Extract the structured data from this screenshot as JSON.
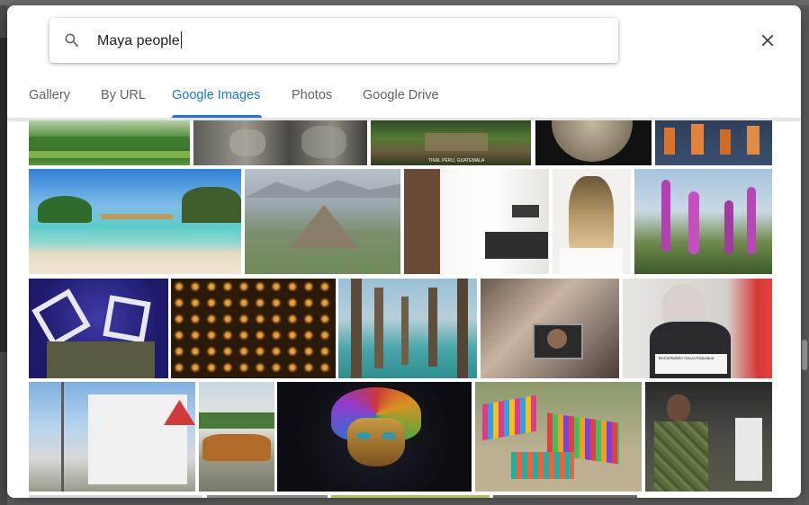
{
  "search": {
    "query": "Maya people"
  },
  "icons": {
    "search": "search-icon",
    "close": "close-icon"
  },
  "tabs": [
    {
      "label": "Gallery",
      "active": false
    },
    {
      "label": "By URL",
      "active": false
    },
    {
      "label": "Google Images",
      "active": true
    },
    {
      "label": "Photos",
      "active": false
    },
    {
      "label": "Google Drive",
      "active": false
    }
  ],
  "colors": {
    "accent": "#1a73e8",
    "tab_inactive": "#5f6368",
    "text": "#202124"
  },
  "images": {
    "row1": [
      "garden hedges",
      "carved stone sculpture",
      "temple ruins jungle",
      "stone calendar disc",
      "mural painting"
    ],
    "row2": [
      "tropical beach",
      "pyramid of the sun",
      "kitchen showroom",
      "blonde hair back view",
      "purple wildflowers"
    ],
    "row3": [
      "soldiers photo frame",
      "patterned textile",
      "wooden pier posts",
      "person in vehicle",
      "woman at desk"
    ],
    "row4": [
      "street with houses",
      "rusted car",
      "colorful carnival mask",
      "colorful hammocks",
      "soldier applauding"
    ]
  },
  "image_captions": {
    "temple_caption": "TIKAL PERU, GUATEMALA",
    "nameplate": "ВАСИЛЬЕВА Ольга Юрьевна"
  }
}
